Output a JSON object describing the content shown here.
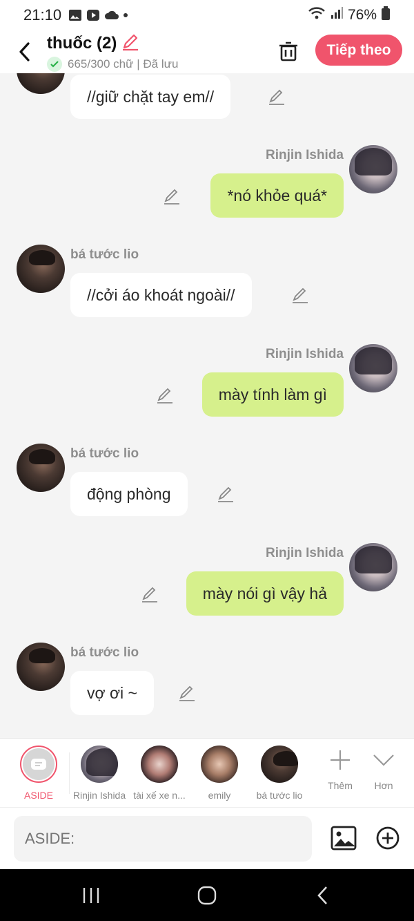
{
  "status_bar": {
    "time": "21:10",
    "battery": "76%"
  },
  "header": {
    "title": "thuốc (2)",
    "subtitle": "665/300 chữ | Đã lưu",
    "next_label": "Tiếp theo"
  },
  "messages": [
    {
      "side": "left",
      "sender": "",
      "text": "//giữ chặt tay em//"
    },
    {
      "side": "right",
      "sender": "Rinjin Ishida",
      "text": "*nó khỏe quá*"
    },
    {
      "side": "left",
      "sender": "bá tước lio",
      "text": "//cởi áo khoát ngoài//"
    },
    {
      "side": "right",
      "sender": "Rinjin Ishida",
      "text": "mày tính làm gì"
    },
    {
      "side": "left",
      "sender": "bá tước lio",
      "text": "động phòng"
    },
    {
      "side": "right",
      "sender": "Rinjin Ishida",
      "text": "mày nói gì vậy hả"
    },
    {
      "side": "left",
      "sender": "bá tước lio",
      "text": "vợ ơi ~"
    }
  ],
  "characters": [
    {
      "name": "ASIDE",
      "active": true
    },
    {
      "name": "Rinjin Ishida"
    },
    {
      "name": "tài xế xe n..."
    },
    {
      "name": "emily"
    },
    {
      "name": "bá tước lio"
    }
  ],
  "actions": {
    "more_label": "Thêm",
    "less_label": "Hơn"
  },
  "input": {
    "placeholder": "ASIDE:"
  },
  "colors": {
    "accent": "#f0546c",
    "right_bubble": "#d6f08c",
    "left_bubble": "#ffffff"
  }
}
